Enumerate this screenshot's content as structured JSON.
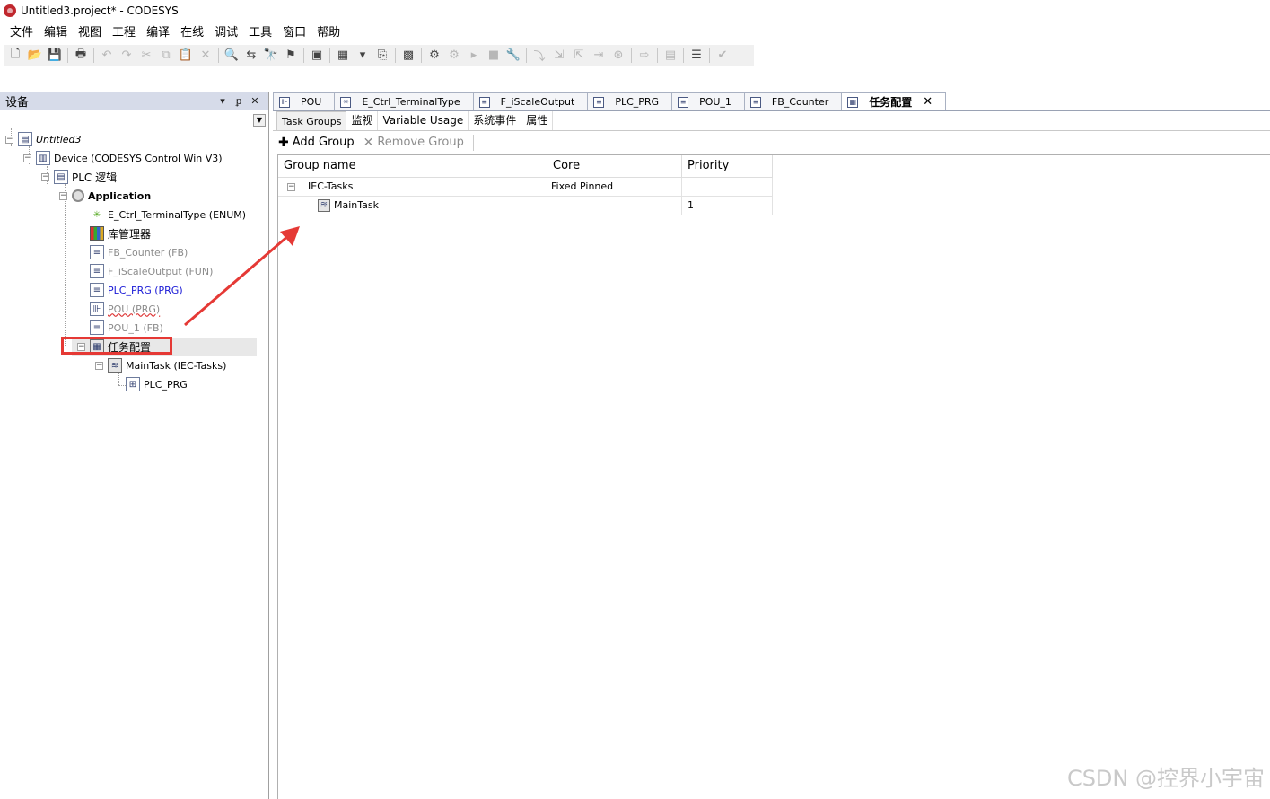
{
  "window": {
    "title": "Untitled3.project* - CODESYS"
  },
  "menu": [
    "文件",
    "编辑",
    "视图",
    "工程",
    "编译",
    "在线",
    "调试",
    "工具",
    "窗口",
    "帮助"
  ],
  "toolbar_icons": [
    {
      "name": "new-file-icon",
      "glyph": "🗋",
      "disabled": false
    },
    {
      "name": "open-folder-icon",
      "glyph": "📂",
      "disabled": false
    },
    {
      "name": "save-icon",
      "glyph": "💾",
      "disabled": false
    },
    {
      "sep": true
    },
    {
      "name": "print-icon",
      "glyph": "🖶",
      "disabled": false
    },
    {
      "sep": true
    },
    {
      "name": "undo-icon",
      "glyph": "↶",
      "disabled": true
    },
    {
      "name": "redo-icon",
      "glyph": "↷",
      "disabled": true
    },
    {
      "name": "cut-icon",
      "glyph": "✂",
      "disabled": true
    },
    {
      "name": "copy-icon",
      "glyph": "⧉",
      "disabled": true
    },
    {
      "name": "paste-icon",
      "glyph": "📋",
      "disabled": true
    },
    {
      "name": "delete-icon",
      "glyph": "✕",
      "disabled": true
    },
    {
      "sep": true
    },
    {
      "name": "find-icon",
      "glyph": "🔍",
      "disabled": false
    },
    {
      "name": "find-replace-icon",
      "glyph": "⇆",
      "disabled": false
    },
    {
      "name": "browse-icon",
      "glyph": "🔭",
      "disabled": false
    },
    {
      "name": "bookmark-icon",
      "glyph": "⚑",
      "disabled": false
    },
    {
      "sep": true
    },
    {
      "name": "window-icon",
      "glyph": "▣",
      "disabled": false
    },
    {
      "sep": true
    },
    {
      "name": "add-object-icon",
      "glyph": "▦",
      "disabled": false
    },
    {
      "name": "dropdown-icon",
      "glyph": "▾",
      "disabled": false
    },
    {
      "name": "properties-icon",
      "glyph": "⎘",
      "disabled": false
    },
    {
      "sep": true
    },
    {
      "name": "build-icon",
      "glyph": "▩",
      "disabled": false
    },
    {
      "sep": true
    },
    {
      "name": "login-icon",
      "glyph": "⚙",
      "disabled": false
    },
    {
      "name": "logout-icon",
      "glyph": "⚙",
      "disabled": true
    },
    {
      "name": "start-icon",
      "glyph": "▸",
      "disabled": true
    },
    {
      "name": "stop-icon",
      "glyph": "■",
      "disabled": true
    },
    {
      "name": "reset-icon",
      "glyph": "🔧",
      "disabled": true
    },
    {
      "sep": true
    },
    {
      "name": "step-over-icon",
      "glyph": "⤵",
      "disabled": true
    },
    {
      "name": "step-into-icon",
      "glyph": "⇲",
      "disabled": true
    },
    {
      "name": "step-out-icon",
      "glyph": "⇱",
      "disabled": true
    },
    {
      "name": "run-to-cursor-icon",
      "glyph": "⇥",
      "disabled": true
    },
    {
      "name": "breakpoint-icon",
      "glyph": "⊛",
      "disabled": true
    },
    {
      "sep": true
    },
    {
      "name": "forward-icon",
      "glyph": "⇨",
      "disabled": true
    },
    {
      "sep": true
    },
    {
      "name": "watch-icon",
      "glyph": "▤",
      "disabled": true
    },
    {
      "sep": true
    },
    {
      "name": "filter-icon",
      "glyph": "☰",
      "disabled": false
    },
    {
      "sep": true
    },
    {
      "name": "check-icon",
      "glyph": "✔",
      "disabled": true
    }
  ],
  "devices_pane": {
    "title": "设备",
    "pin_glyph": "▾",
    "autohide_glyph": "ᵱ",
    "close_glyph": "✕"
  },
  "tree": {
    "project": "Untitled3",
    "device": "Device (CODESYS Control Win V3)",
    "plc_logic": "PLC 逻辑",
    "application": "Application",
    "items": [
      {
        "label": "E_Ctrl_TerminalType (ENUM)",
        "style": "normal",
        "icon": "enum"
      },
      {
        "label": "库管理器",
        "style": "large",
        "icon": "lib"
      },
      {
        "label": "FB_Counter (FB)",
        "style": "gray",
        "icon": "doc"
      },
      {
        "label": "F_iScaleOutput (FUN)",
        "style": "gray",
        "icon": "doc"
      },
      {
        "label": "PLC_PRG (PRG)",
        "style": "blue",
        "icon": "doc"
      },
      {
        "label": "POU (PRG)",
        "style": "gray-wavy",
        "icon": "ladder"
      },
      {
        "label": "POU_1 (FB)",
        "style": "gray",
        "icon": "doc"
      }
    ],
    "task_config": "任务配置",
    "main_task": "MainTask (IEC-Tasks)",
    "plc_prg_call": "PLC_PRG"
  },
  "doc_tabs": [
    {
      "label": "POU",
      "icon": "ladder",
      "active": false
    },
    {
      "label": "E_Ctrl_TerminalType",
      "icon": "enum",
      "active": false
    },
    {
      "label": "F_iScaleOutput",
      "icon": "doc",
      "active": false
    },
    {
      "label": "PLC_PRG",
      "icon": "doc",
      "active": false
    },
    {
      "label": "POU_1",
      "icon": "doc",
      "active": false
    },
    {
      "label": "FB_Counter",
      "icon": "doc",
      "active": false
    },
    {
      "label": "任务配置",
      "icon": "task",
      "active": true
    }
  ],
  "sub_tabs": [
    "Task Groups",
    "监视",
    "Variable Usage",
    "系统事件",
    "属性"
  ],
  "group_toolbar": {
    "add": "Add Group",
    "remove": "Remove Group"
  },
  "grid": {
    "columns": [
      "Group name",
      "Core",
      "Priority"
    ],
    "rows": [
      {
        "name": "IEC-Tasks",
        "core": "Fixed Pinned",
        "priority": "",
        "level": 0
      },
      {
        "name": "MainTask",
        "core": "",
        "priority": "1",
        "level": 1
      }
    ]
  },
  "colors": {
    "annotation": "#e53935",
    "pane_header": "#d6dbe9"
  },
  "watermark": "CSDN @控界小宇宙"
}
